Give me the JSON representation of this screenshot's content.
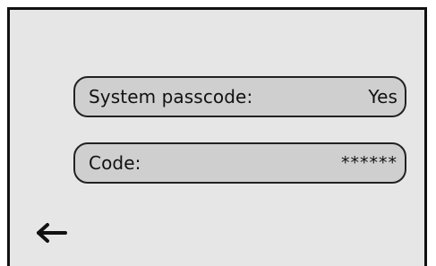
{
  "settings": {
    "system_passcode": {
      "label": "System passcode:",
      "value": "Yes"
    },
    "code": {
      "label": "Code:",
      "value": "******"
    }
  },
  "nav": {
    "back_icon": "arrow-left-icon"
  },
  "colors": {
    "screen_bg": "#e6e6e6",
    "field_bg": "#cfcfcf",
    "border": "#222222",
    "text": "#111111"
  }
}
